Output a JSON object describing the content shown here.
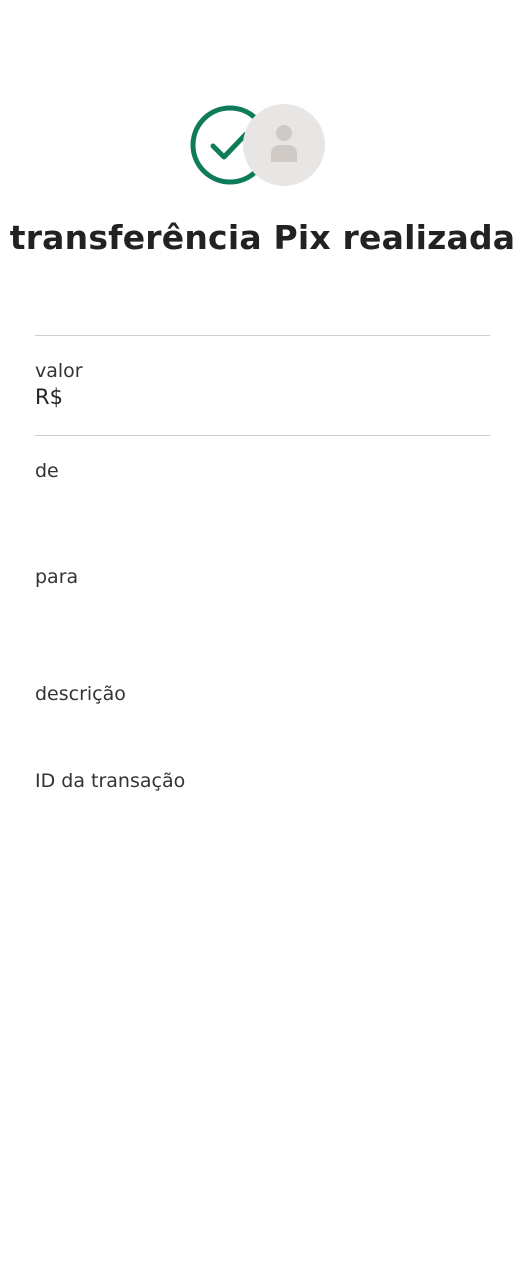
{
  "header": {
    "title": "transferência Pix realizada",
    "status_icon": "check-circle-icon",
    "avatar_icon": "person-icon",
    "colors": {
      "success": "#0e7b5a",
      "avatar_bg": "#e8e6e4",
      "avatar_fg": "#cfcac6"
    }
  },
  "details": {
    "valor_label": "valor",
    "valor_value": "R$",
    "de_label": "de",
    "para_label": "para",
    "descricao_label": "descrição",
    "id_label": "ID da transação"
  }
}
